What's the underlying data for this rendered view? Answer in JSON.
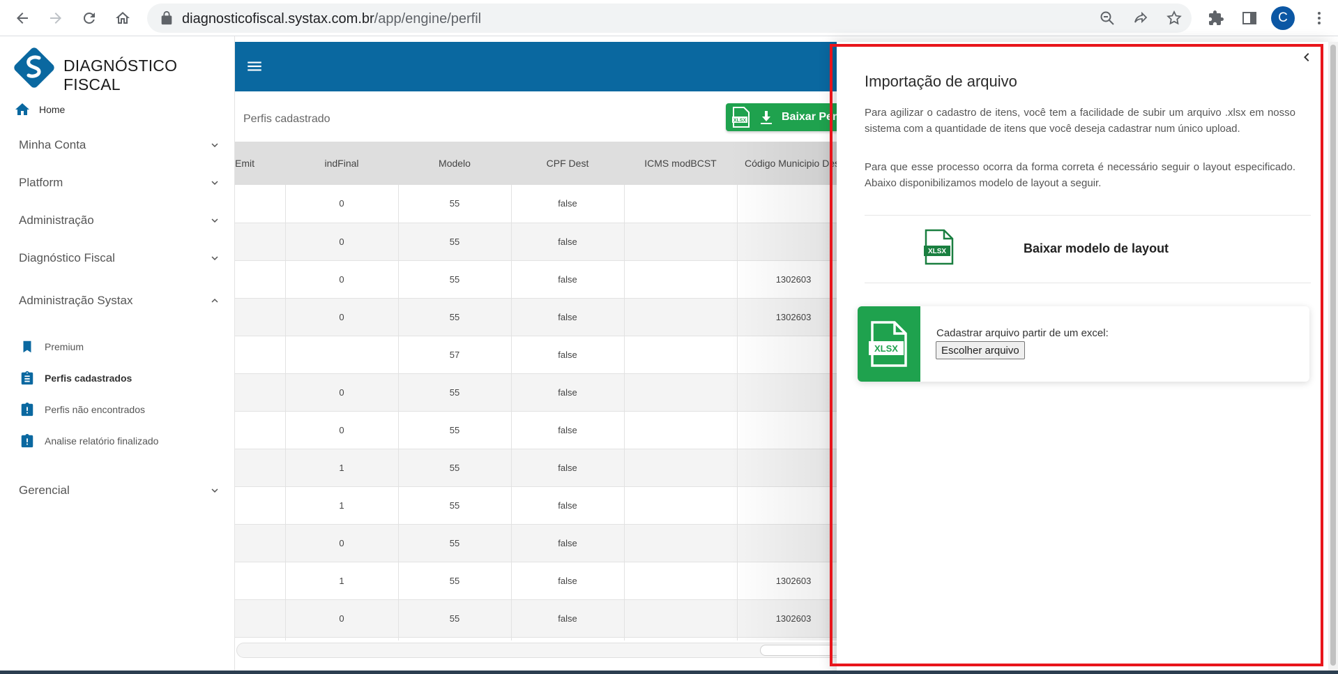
{
  "browser": {
    "url_domain": "diagnosticofiscal.systax.com.br",
    "url_path": "/app/engine/perfil",
    "profile_initial": "C"
  },
  "app": {
    "brand": "DIAGNÓSTICO FISCAL",
    "accent": "#0a68a0",
    "success": "#1fa24e"
  },
  "sidebar": {
    "home": "Home",
    "groups": [
      {
        "label": "Minha Conta",
        "expanded": false
      },
      {
        "label": "Platform",
        "expanded": false
      },
      {
        "label": "Administração",
        "expanded": false
      },
      {
        "label": "Diagnóstico Fiscal",
        "expanded": false
      },
      {
        "label": "Administração Systax",
        "expanded": true
      },
      {
        "label": "Gerencial",
        "expanded": false
      }
    ],
    "sub_items": [
      {
        "label": "Premium",
        "icon": "bookmark-icon",
        "active": false
      },
      {
        "label": "Perfis cadastrados",
        "icon": "clipboard-icon",
        "active": true
      },
      {
        "label": "Perfis não encontrados",
        "icon": "clipboard-alert-icon",
        "active": false
      },
      {
        "label": "Analise relatório finalizado",
        "icon": "clipboard-alert-icon",
        "active": false
      }
    ]
  },
  "main": {
    "section_title": "Perfis cadastrado",
    "download_button": "Baixar Perfis",
    "table": {
      "headers": [
        "Emit",
        "indFinal",
        "Modelo",
        "CPF Dest",
        "ICMS modBCST",
        "Código Municipio Dest"
      ],
      "rows": [
        [
          "",
          "0",
          "55",
          "false",
          "",
          ""
        ],
        [
          "",
          "0",
          "55",
          "false",
          "",
          ""
        ],
        [
          "",
          "0",
          "55",
          "false",
          "",
          "1302603"
        ],
        [
          "",
          "0",
          "55",
          "false",
          "",
          "1302603"
        ],
        [
          "",
          "",
          "57",
          "false",
          "",
          ""
        ],
        [
          "",
          "0",
          "55",
          "false",
          "",
          ""
        ],
        [
          "",
          "0",
          "55",
          "false",
          "",
          ""
        ],
        [
          "",
          "1",
          "55",
          "false",
          "",
          ""
        ],
        [
          "",
          "1",
          "55",
          "false",
          "",
          ""
        ],
        [
          "",
          "0",
          "55",
          "false",
          "",
          ""
        ],
        [
          "",
          "1",
          "55",
          "false",
          "",
          "1302603"
        ],
        [
          "",
          "0",
          "55",
          "false",
          "",
          "1302603"
        ],
        [
          "",
          "",
          "",
          "",
          "",
          ""
        ]
      ]
    }
  },
  "drawer": {
    "title": "Importação de arquivo",
    "paragraph1": "Para agilizar o cadastro de itens, você tem a facilidade de subir um arquivo .xlsx em nosso sistema com a quantidade de itens que você deseja cadastrar num único upload.",
    "paragraph2": "Para que esse processo ocorra da forma correta é necessário seguir o layout especificado. Abaixo disponibilizamos modelo de layout a seguir.",
    "model_link": "Baixar modelo de layout",
    "xlsx_badge": "XLSX",
    "upload_caption": "Cadastrar arquivo partir de um excel:",
    "file_button": "Escolher arquivo"
  }
}
